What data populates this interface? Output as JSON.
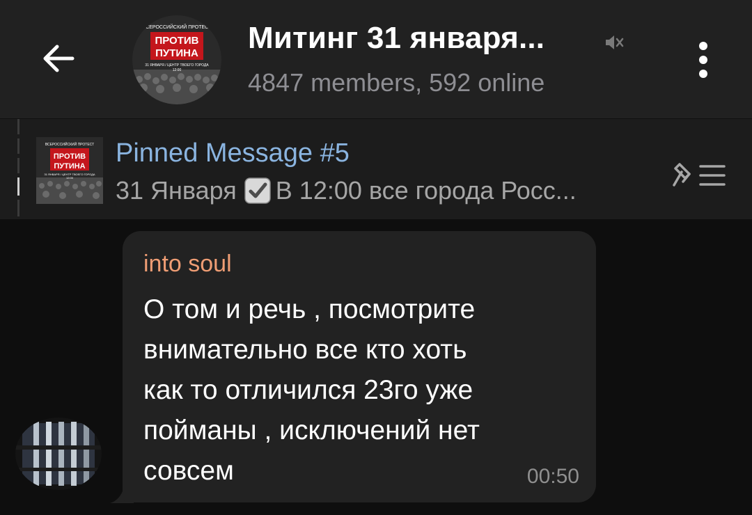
{
  "header": {
    "title": "Митинг 31 января...",
    "subtitle": "4847 members, 592 online",
    "avatar_lines": [
      "ВСЕРОССИЙСКИЙ ПРОТЕСТ",
      "ПРОТИВ",
      "ПУТИНА",
      "31 ЯНВАРЯ / ЦЕНТР ТВОЕГО ГОРОДА",
      "12:00"
    ],
    "icons": {
      "back": "arrow-left-icon",
      "mute": "muted-speaker-icon",
      "menu": "kebab-menu-icon"
    }
  },
  "pinned": {
    "title": "Pinned Message #5",
    "text_before": "31 Января",
    "text_after": "В 12:00 все города Росс...",
    "icons": {
      "check": "checkbox-checked-icon",
      "list": "pinned-list-icon"
    }
  },
  "message": {
    "sender": "into soul",
    "text": "О том и речь , посмотрите\nвнимательно все кто хоть\nкак то отличился 23го уже\nпойманы , исключений нет\nсовсем",
    "time": "00:50"
  },
  "colors": {
    "header_bg": "#212121",
    "pinned_bg": "#1c1c1c",
    "chat_bg": "#0e0e0e",
    "bubble_bg": "#222222",
    "sender": "#ef9d74",
    "pinned_title": "#8ab4e0",
    "avatar_red": "#c4161c"
  }
}
